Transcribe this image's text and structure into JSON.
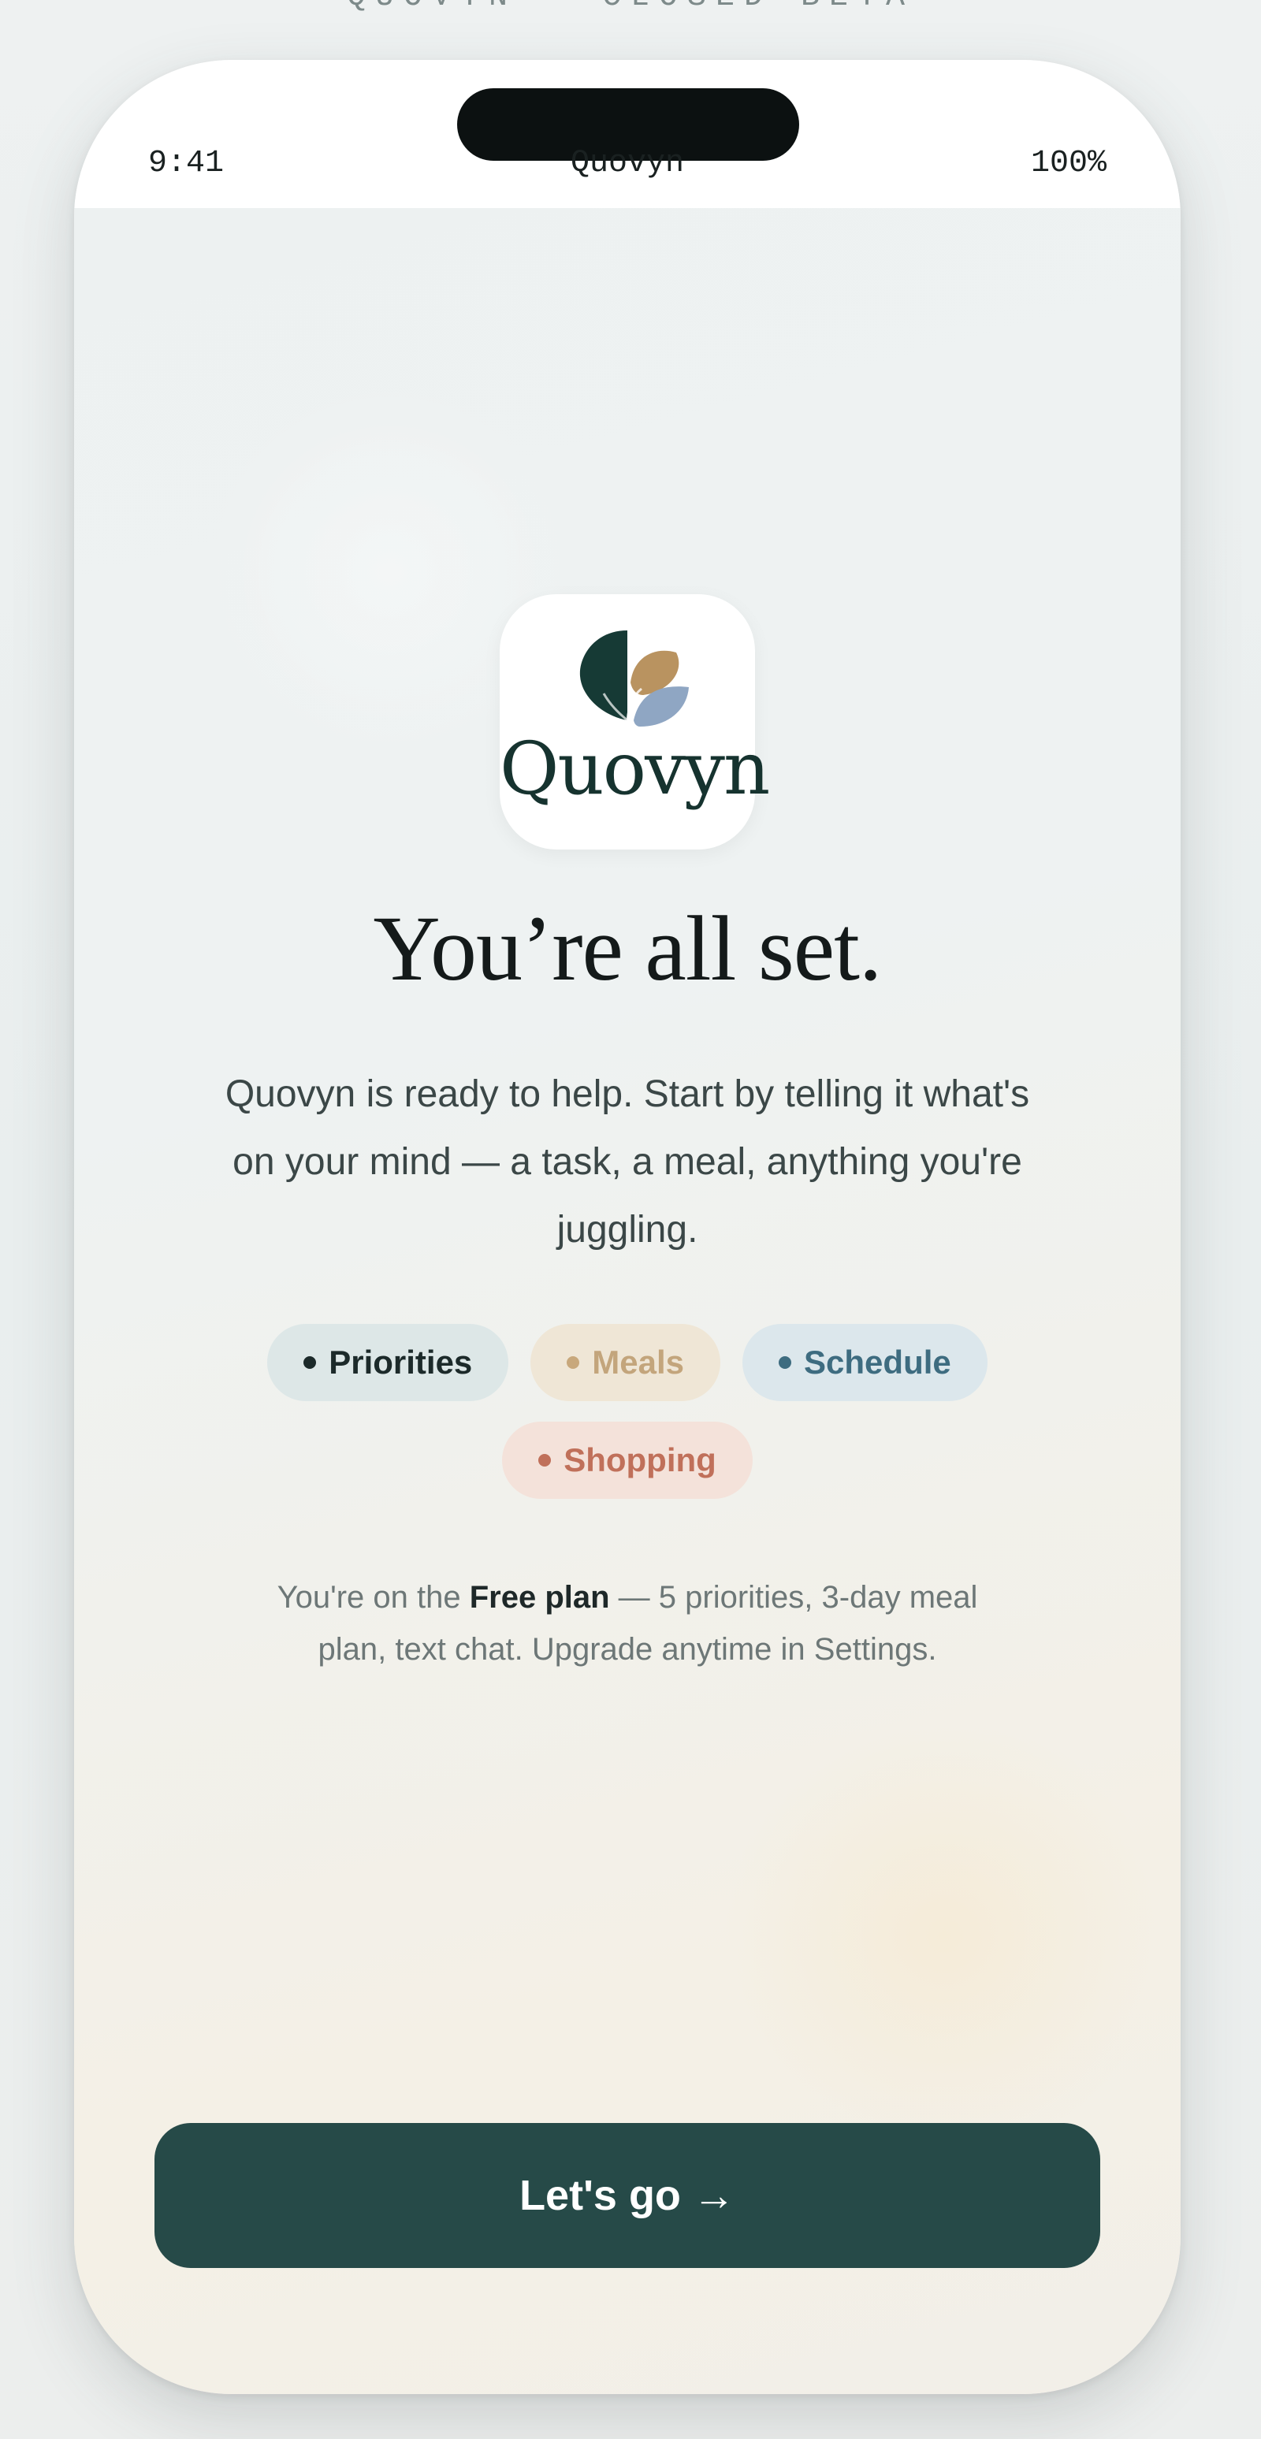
{
  "page": {
    "caption": "QUOVYN · CLOSED BETA"
  },
  "status_bar": {
    "time": "9:41",
    "title": "Quovyn",
    "battery": "100%"
  },
  "logo": {
    "wordmark": "Quovyn",
    "colors": {
      "leaf_dark": "#163a35",
      "leaf_gold": "#b99360",
      "leaf_blue": "#8fa6c3"
    }
  },
  "onboarding": {
    "headline": "You’re all set.",
    "subtitle": "Quovyn is ready to help. Start by telling it what's on your mind — a task, a meal, anything you're juggling.",
    "chips": [
      {
        "label": "Priorities"
      },
      {
        "label": "Meals"
      },
      {
        "label": "Schedule"
      },
      {
        "label": "Shopping"
      }
    ],
    "plan_prefix": "You're on the ",
    "plan_name": "Free plan",
    "plan_suffix": " — 5 priorities, 3-day meal plan, text chat. Upgrade anytime in Settings."
  },
  "cta": {
    "label": "Let's go →",
    "color": "#264a48"
  }
}
